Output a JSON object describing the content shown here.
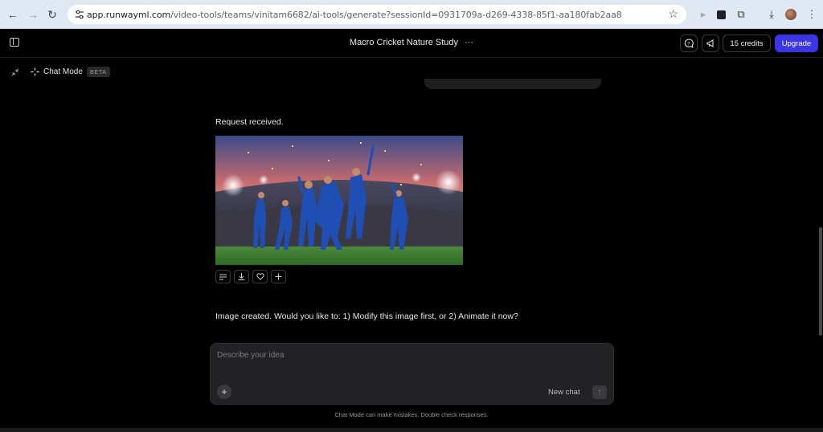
{
  "browser": {
    "url_host": "app.runwayml.com",
    "url_path": "/video-tools/teams/vinitam6682/ai-tools/generate?sessionId=0931709a-d269-4338-85f1-aa180fab2aa8"
  },
  "header": {
    "title": "Macro Cricket Nature Study",
    "more_glyph": "···",
    "credits_label": "15 credits",
    "upgrade_label": "Upgrade"
  },
  "mode": {
    "label": "Chat Mode",
    "badge": "BETA"
  },
  "conversation": {
    "request_text": "Request received.",
    "result_text": "Image created. Would you like to: 1) Modify this image first, or 2) Animate it now?"
  },
  "composer": {
    "placeholder": "Describe your idea",
    "new_chat_label": "New chat"
  },
  "footer": {
    "disclaimer": "Chat Mode can make mistakes. Double check responses."
  },
  "colors": {
    "accent": "#3b35e8",
    "background": "#000000",
    "composer_bg": "#222225"
  }
}
